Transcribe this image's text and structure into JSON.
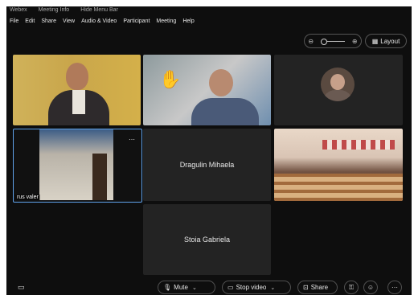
{
  "titlebar": {
    "app": "Webex",
    "meeting_info": "Meeting Info",
    "hide_menu": "Hide Menu Bar"
  },
  "menu": {
    "items": [
      "File",
      "Edit",
      "Share",
      "View",
      "Audio & Video",
      "Participant",
      "Meeting",
      "Help"
    ]
  },
  "view_controls": {
    "layout_label": "Layout"
  },
  "tiles": {
    "t4_label": "rus valer",
    "t5_name": "Dragulin Mihaela",
    "t7_name": "Stoia Gabriela"
  },
  "controls": {
    "mute": "Mute",
    "stop_video": "Stop video",
    "share": "Share"
  },
  "colors": {
    "background": "#0e0e0e",
    "active_border": "#5fa2ea",
    "tile": "#232323"
  }
}
